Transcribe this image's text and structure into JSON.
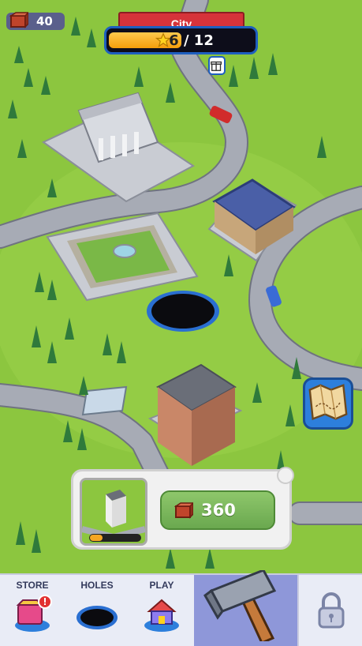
{
  "hud": {
    "bricks": "40",
    "city_label": "City",
    "progress_current": "6",
    "progress_sep": "/ 12",
    "progress_fraction": 0.5
  },
  "card": {
    "build_cost": "360",
    "thumb_progress": 0.25
  },
  "nav": {
    "items": [
      {
        "label": "STORE"
      },
      {
        "label": "HOLES"
      },
      {
        "label": "PLAY"
      }
    ]
  },
  "colors": {
    "grass": "#8cc63f",
    "road": "#9fa3ad",
    "banner": "#d6333a",
    "accent_blue": "#1e5fbf",
    "nav_active": "#8e97d9"
  },
  "icons": [
    "brick-icon",
    "star-icon",
    "gift-icon",
    "map-icon",
    "store-icon",
    "hole-icon",
    "house-icon",
    "hammer-icon",
    "lock-icon"
  ]
}
